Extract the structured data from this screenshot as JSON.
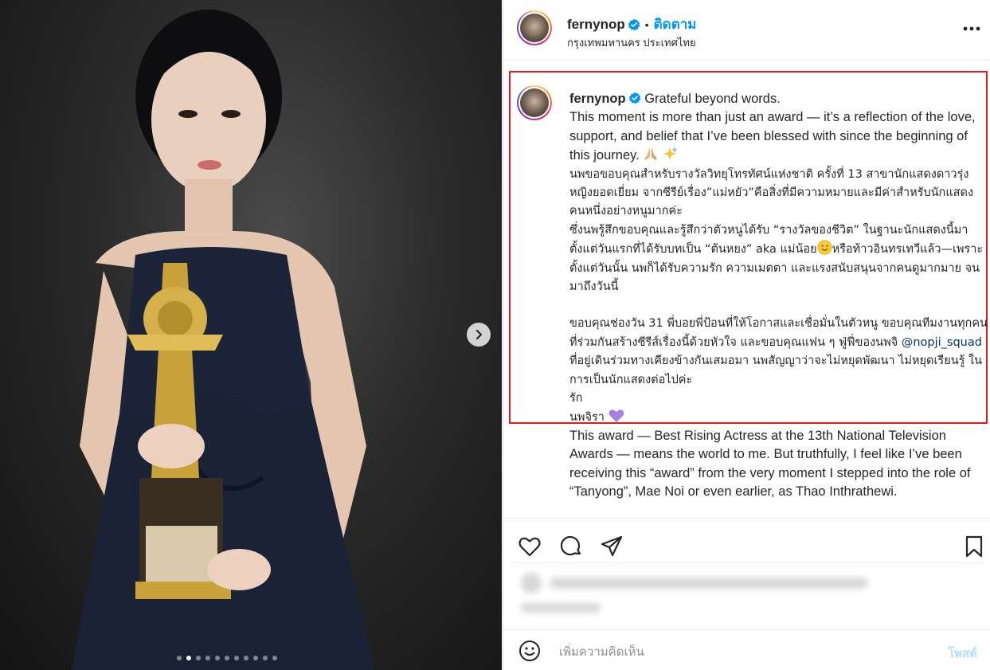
{
  "header": {
    "username": "fernynop",
    "separator": "•",
    "follow_label": "ติดตาม",
    "location": "กรุงเทพมหานคร ประเทศไทย"
  },
  "caption": {
    "username": "fernynop",
    "line_en_1": "Grateful beyond words.",
    "line_en_2": "This moment is more than just an award — it’s a reflection of the love, support, and belief that I’ve been blessed with since the beginning of this journey.",
    "th_para_1": "นพขอขอบคุณสำหรับรางวัลวิทยุโทรทัศน์แห่งชาติ ครั้งที่ 13 สาขานักแสดงดาวรุ่งหญิงยอดเยี่ยม จากซีรีย์เรื่อง”แม่หยัว”คือสิ่งที่มีความหมายและมีค่าสำหรับนักแสดงคนหนึ่งอย่างหนูมากค่ะ",
    "th_para_2a": "ซึ่งนพรู้สึกขอบคุณและรู้สึกว่าตัวหนูได้รับ “รางวัลของชีวิต” ในฐานะนักแสดงนี้มาตั้งแต่วันแรกที่ได้รับบทเป็น “ต้นหยง” aka แม่น้อย",
    "th_para_2b": "หรือท้าวอินทรเทวีแล้ว—เพราะตั้งแต่วันนั้น นพก็ได้รับความรัก ความเมตตา และแรงสนับสนุนจากคนดูมากมาย จนมาถึงวันนี้",
    "th_para_3a": "ขอบคุณช่องวัน 31 พี่บอยพี่ป้อนที่ให้โอกาสและเชื่อมั่นในตัวหนู ขอบคุณทีมงานทุกคนที่ร่วมกันสร้างซีรีส์เรื่องนี้ด้วยหัวใจ และขอบคุณแฟน ๆ ฟู่ฟี่ของนพจิ",
    "mention": "@nopji_squad",
    "th_para_3b": "ที่อยู่เดินร่วมทางเคียงข้างกันเสมอมา นพสัญญาว่าจะไม่หยุดพัฒนา ไม่หยุดเรียนรู้ ในการเป็นนักแสดงต่อไปค่ะ",
    "th_love": "รัก",
    "th_sign": "นพจิรา",
    "en_para_2": "This award — Best Rising Actress at the 13th National Television Awards — means the world to me. But truthfully, I feel like I’ve been receiving this “award” from the very moment I stepped into the role of “Tanyong”, Mae Noi or even earlier, as Thao Inthrathewi."
  },
  "comment": {
    "placeholder": "เพิ่มความคิดเห็น",
    "post_label": "โพสต์"
  },
  "carousel": {
    "total": 11,
    "active_index": 1
  },
  "colors": {
    "accent": "#0095f6",
    "highlight": "#e0191a",
    "verified": "#0095f6"
  },
  "icons": [
    "chevron-right-icon",
    "verified-icon",
    "more-icon",
    "heart-icon",
    "comment-icon",
    "share-icon",
    "bookmark-icon",
    "emoji-icon",
    "praying-hands-icon",
    "sparkles-icon",
    "smile-icon",
    "purple-heart-icon"
  ]
}
